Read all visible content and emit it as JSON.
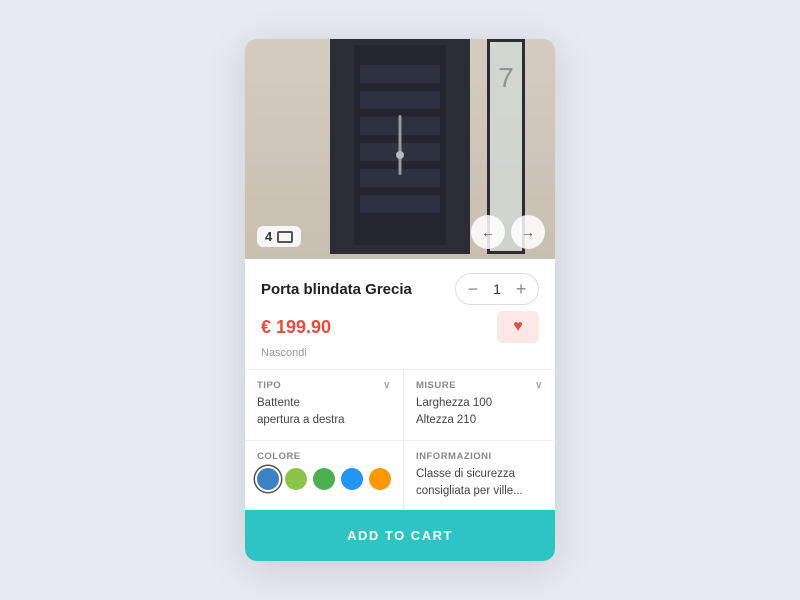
{
  "card": {
    "image": {
      "count": "4",
      "door_number": "7",
      "alt": "Porta blindata Grecia"
    },
    "nav": {
      "prev_label": "←",
      "next_label": "→"
    },
    "product": {
      "title": "Porta blindata Grecia",
      "price": "€ 199.90",
      "hide_label": "Nascondi",
      "quantity": "1"
    },
    "specs": {
      "tipo_label": "TIPO",
      "tipo_value": "Battente apertura a destra",
      "misure_label": "MISURE",
      "misure_value": "Larghezza 100\nAltezza 210",
      "colore_label": "COLORE",
      "informazioni_label": "INFORMAZIONI",
      "informazioni_value": "Classe di sicurezza consigliata per ville..."
    },
    "swatches": [
      {
        "color": "#3b82c4",
        "selected": true
      },
      {
        "color": "#8bc34a",
        "selected": false
      },
      {
        "color": "#4caf50",
        "selected": false
      },
      {
        "color": "#2196f3",
        "selected": false
      },
      {
        "color": "#ff9800",
        "selected": false
      }
    ],
    "cta": {
      "label": "ADD TO CART"
    }
  }
}
